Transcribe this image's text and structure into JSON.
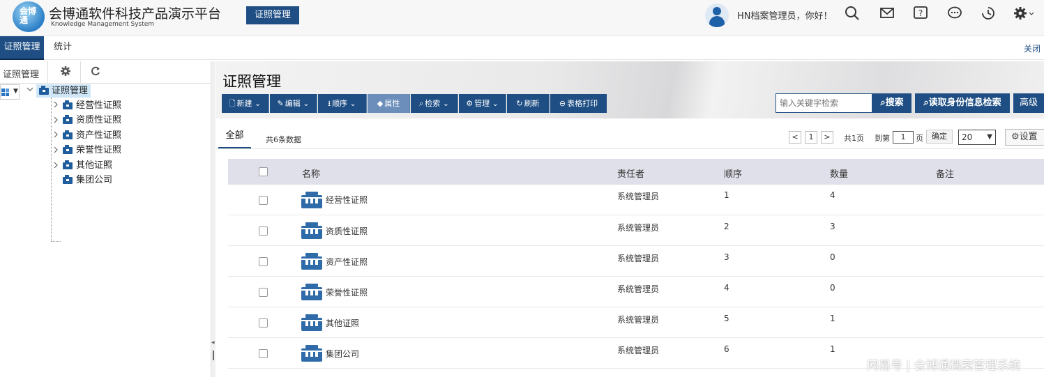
{
  "header": {
    "logo_text": "会博通",
    "brand_title": "会博通软件科技产品演示平台",
    "brand_subtitle": "Knowledge Management System",
    "module_badge": "证照管理",
    "greeting": "HN档案管理员，你好！",
    "icons": [
      "search-icon",
      "mail-icon",
      "help-icon",
      "chat-icon",
      "history-icon",
      "gear-icon"
    ]
  },
  "tabs": {
    "items": [
      {
        "label": "证照管理",
        "active": true
      },
      {
        "label": "统计",
        "active": false
      }
    ],
    "close_label": "关闭"
  },
  "left_panel": {
    "title": "证照管理",
    "tree_root": "证照管理",
    "tree_nodes": [
      "经营性证照",
      "资质性证照",
      "资产性证照",
      "荣誉性证照",
      "其他证照",
      "集团公司"
    ]
  },
  "main": {
    "page_title": "证照管理",
    "toolbar": [
      {
        "label": "新建",
        "dropdown": true
      },
      {
        "label": "编辑",
        "dropdown": true
      },
      {
        "label": "顺序",
        "dropdown": true
      },
      {
        "label": "属性",
        "dropdown": false
      },
      {
        "label": "检索",
        "dropdown": true
      },
      {
        "label": "管理",
        "dropdown": true
      },
      {
        "label": "刷新",
        "dropdown": false
      },
      {
        "label": "表格打印",
        "dropdown": false
      }
    ],
    "search": {
      "placeholder": "输入关键字检索",
      "search_label": "搜索",
      "id_search_label": "读取身份信息检索",
      "advanced_label": "高级"
    },
    "subtab_all": "全部",
    "count_text": "共6条数据",
    "pager": {
      "prev": "<",
      "current": "1",
      "next": ">",
      "total_pages": "共1页",
      "goto_label": "到第",
      "goto_value": "1",
      "page_suffix": "页",
      "confirm": "确定",
      "page_size": "20",
      "settings": "设置"
    },
    "table": {
      "columns": [
        "名称",
        "责任者",
        "顺序",
        "数量",
        "备注"
      ],
      "rows": [
        {
          "name": "经营性证照",
          "owner": "系统管理员",
          "order": "1",
          "count": "4",
          "note": ""
        },
        {
          "name": "资质性证照",
          "owner": "系统管理员",
          "order": "2",
          "count": "3",
          "note": ""
        },
        {
          "name": "资产性证照",
          "owner": "系统管理员",
          "order": "3",
          "count": "0",
          "note": ""
        },
        {
          "name": "荣誉性证照",
          "owner": "系统管理员",
          "order": "4",
          "count": "0",
          "note": ""
        },
        {
          "name": "其他证照",
          "owner": "系统管理员",
          "order": "5",
          "count": "1",
          "note": ""
        },
        {
          "name": "集团公司",
          "owner": "系统管理员",
          "order": "6",
          "count": "1",
          "note": ""
        }
      ]
    }
  },
  "watermark": "网易号 | 会博通档案管理系统",
  "colors": {
    "primary": "#1e4e83",
    "selected_toolbar": "#6b8fba",
    "table_header": "#e0e0ea",
    "tree_selected": "#cfe6f7"
  }
}
